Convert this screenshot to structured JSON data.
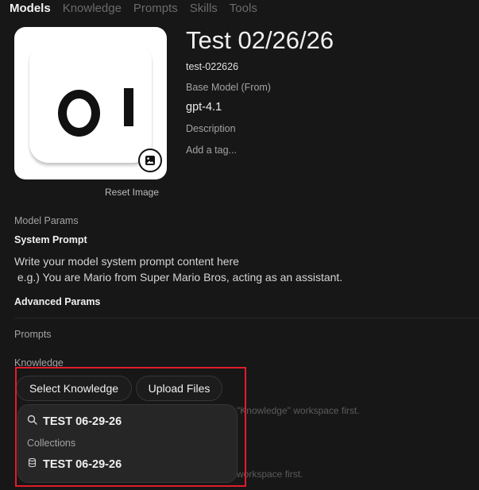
{
  "nav": {
    "tabs": [
      {
        "label": "Models",
        "active": true
      },
      {
        "label": "Knowledge",
        "active": false
      },
      {
        "label": "Prompts",
        "active": false
      },
      {
        "label": "Skills",
        "active": false
      },
      {
        "label": "Tools",
        "active": false
      }
    ]
  },
  "model": {
    "name": "Test 02/26/26",
    "id": "test-022626",
    "base_model_label": "Base Model (From)",
    "base_model_value": "gpt-4.1",
    "description_label": "Description",
    "tag_placeholder": "Add a tag...",
    "image_edit_icon": "image-icon",
    "reset_image_label": "Reset Image"
  },
  "params": {
    "section_label": "Model Params",
    "system_prompt_label": "System Prompt",
    "system_prompt_placeholder": "Write your model system prompt content here\n e.g.) You are Mario from Super Mario Bros, acting as an assistant.",
    "advanced_params_label": "Advanced Params"
  },
  "prompts": {
    "label": "Prompts"
  },
  "knowledge": {
    "label": "Knowledge",
    "select_button": "Select Knowledge",
    "upload_button": "Upload Files",
    "hint_fragment_1": "\"Knowledge\" workspace first.",
    "hint_fragment_2": "workspace first."
  },
  "dropdown": {
    "search_value": "TEST 06-29-26",
    "search_icon": "search-icon",
    "section_label": "Collections",
    "items": [
      {
        "label": "TEST 06-29-26",
        "icon": "database-icon"
      }
    ]
  },
  "colors": {
    "background": "#171717",
    "highlight": "#e11d2a"
  }
}
